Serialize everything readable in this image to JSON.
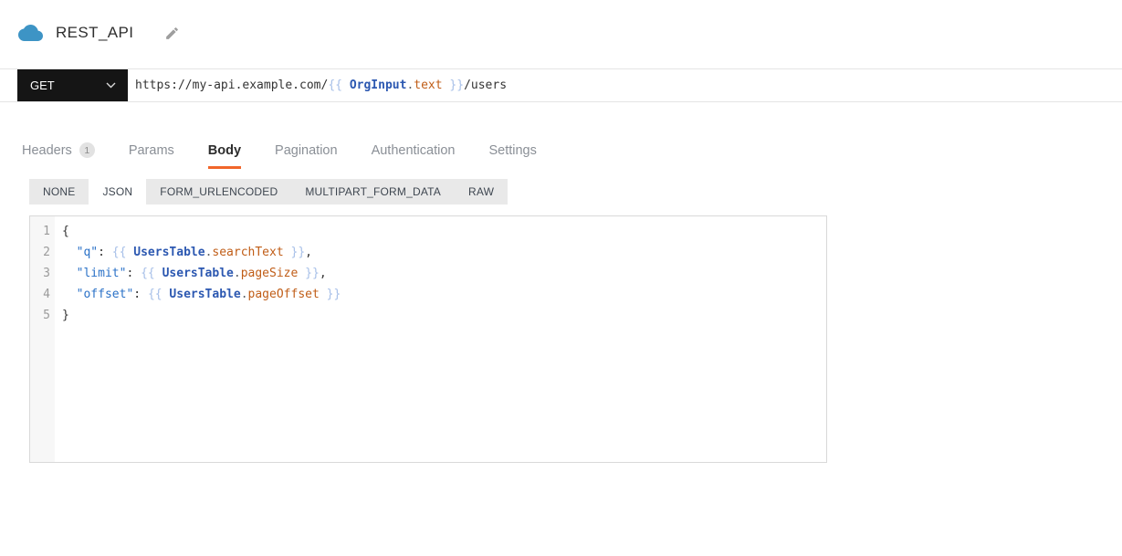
{
  "header": {
    "title": "REST_API"
  },
  "request": {
    "method": "GET",
    "url_tokens": [
      {
        "text": "https://my-api.example.com/",
        "type": "plain"
      },
      {
        "text": "{{ ",
        "type": "brace"
      },
      {
        "text": "OrgInput",
        "type": "component"
      },
      {
        "text": ".",
        "type": "dot"
      },
      {
        "text": "text",
        "type": "prop"
      },
      {
        "text": " }}",
        "type": "brace"
      },
      {
        "text": "/users",
        "type": "plain"
      }
    ]
  },
  "tabs": {
    "items": [
      {
        "label": "Headers",
        "badge": "1",
        "active": false
      },
      {
        "label": "Params",
        "active": false
      },
      {
        "label": "Body",
        "active": true
      },
      {
        "label": "Pagination",
        "active": false
      },
      {
        "label": "Authentication",
        "active": false
      },
      {
        "label": "Settings",
        "active": false
      }
    ]
  },
  "body_type_tabs": {
    "items": [
      {
        "label": "NONE",
        "active": false
      },
      {
        "label": "JSON",
        "active": true
      },
      {
        "label": "FORM_URLENCODED",
        "active": false
      },
      {
        "label": "MULTIPART_FORM_DATA",
        "active": false
      },
      {
        "label": "RAW",
        "active": false
      }
    ]
  },
  "editor": {
    "lines": [
      {
        "number": "1",
        "tokens": [
          {
            "text": "{",
            "type": "plain"
          }
        ]
      },
      {
        "number": "2",
        "tokens": [
          {
            "text": "  ",
            "type": "plain"
          },
          {
            "text": "\"q\"",
            "type": "key"
          },
          {
            "text": ": ",
            "type": "plain"
          },
          {
            "text": "{{ ",
            "type": "brace"
          },
          {
            "text": "UsersTable",
            "type": "component"
          },
          {
            "text": ".",
            "type": "dot"
          },
          {
            "text": "searchText",
            "type": "prop"
          },
          {
            "text": " }}",
            "type": "brace"
          },
          {
            "text": ",",
            "type": "plain"
          }
        ]
      },
      {
        "number": "3",
        "tokens": [
          {
            "text": "  ",
            "type": "plain"
          },
          {
            "text": "\"limit\"",
            "type": "key"
          },
          {
            "text": ": ",
            "type": "plain"
          },
          {
            "text": "{{ ",
            "type": "brace"
          },
          {
            "text": "UsersTable",
            "type": "component"
          },
          {
            "text": ".",
            "type": "dot"
          },
          {
            "text": "pageSize",
            "type": "prop"
          },
          {
            "text": " }}",
            "type": "brace"
          },
          {
            "text": ",",
            "type": "plain"
          }
        ]
      },
      {
        "number": "4",
        "tokens": [
          {
            "text": "  ",
            "type": "plain"
          },
          {
            "text": "\"offset\"",
            "type": "key"
          },
          {
            "text": ": ",
            "type": "plain"
          },
          {
            "text": "{{ ",
            "type": "brace"
          },
          {
            "text": "UsersTable",
            "type": "component"
          },
          {
            "text": ".",
            "type": "dot"
          },
          {
            "text": "pageOffset",
            "type": "prop"
          },
          {
            "text": " }}",
            "type": "brace"
          }
        ]
      },
      {
        "number": "5",
        "tokens": [
          {
            "text": "}",
            "type": "plain"
          }
        ]
      }
    ]
  },
  "icons": {
    "cloud": "cloud-icon",
    "edit": "edit-pencil-icon",
    "chevron": "chevron-down-icon"
  },
  "colors": {
    "accent_orange": "#f1662a",
    "method_bg": "#151515",
    "cloud_blue": "#3d94c5",
    "token_key": "#2a71c7",
    "token_brace": "#a6bfe8",
    "token_component": "#2c58b1",
    "token_prop": "#c05d17"
  }
}
